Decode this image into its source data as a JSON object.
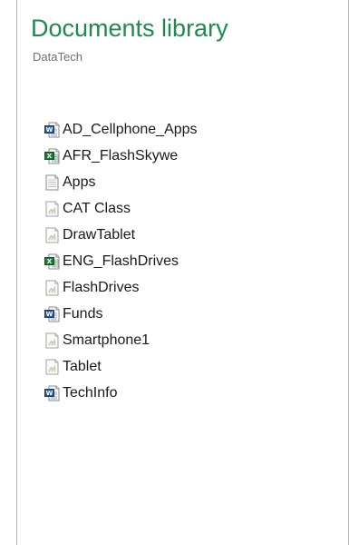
{
  "library": {
    "title": "Documents library",
    "subtitle": "DataTech"
  },
  "files": [
    {
      "name": "AD_Cellphone_Apps",
      "icon": "word-document-icon"
    },
    {
      "name": "AFR_FlashSkywe",
      "icon": "excel-spreadsheet-icon"
    },
    {
      "name": "Apps",
      "icon": "text-document-icon"
    },
    {
      "name": "CAT Class",
      "icon": "generic-file-icon"
    },
    {
      "name": "DrawTablet",
      "icon": "generic-file-icon"
    },
    {
      "name": "ENG_FlashDrives",
      "icon": "excel-spreadsheet-icon"
    },
    {
      "name": "FlashDrives",
      "icon": "generic-file-icon"
    },
    {
      "name": "Funds",
      "icon": "word-document-icon"
    },
    {
      "name": "Smartphone1",
      "icon": "generic-file-icon"
    },
    {
      "name": "Tablet",
      "icon": "generic-file-icon"
    },
    {
      "name": "TechInfo",
      "icon": "word-document-icon"
    }
  ],
  "colors": {
    "title": "#1e8a4f",
    "word": "#2b5797",
    "excel": "#1f7a3a"
  }
}
